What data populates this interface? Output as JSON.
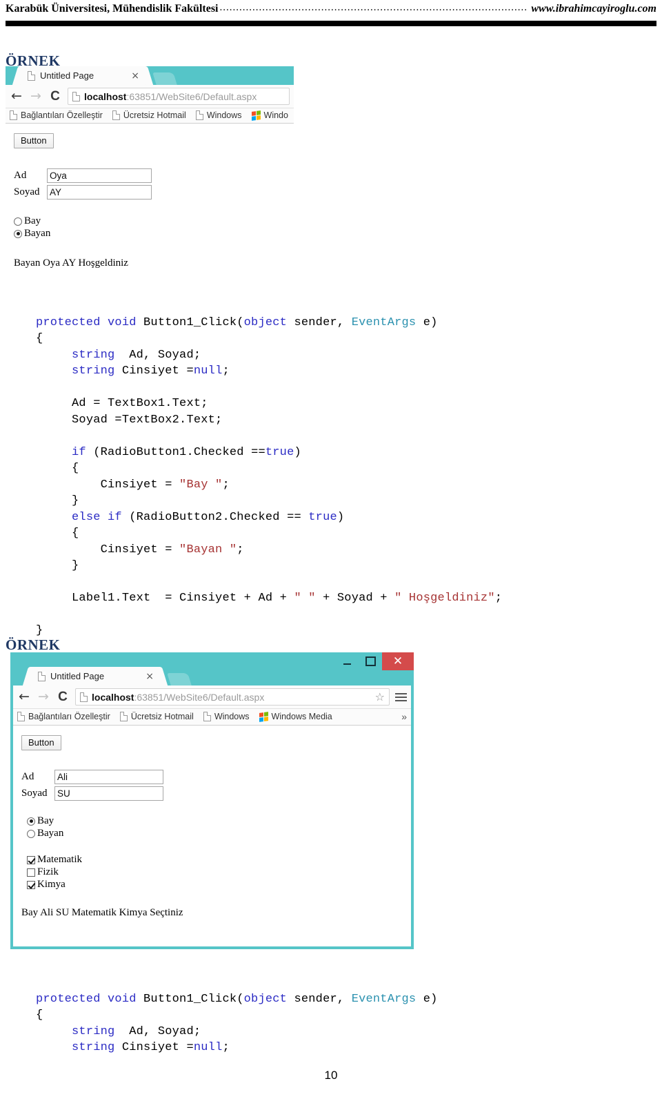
{
  "header": {
    "left": "Karabük Üniversitesi, Mühendislik Fakültesi",
    "dots": "..............................................................................................",
    "right": "www.ibrahimcayiroglu.com"
  },
  "sections": {
    "ornek_1": "ÖRNEK",
    "ornek_2": "ÖRNEK"
  },
  "browser1": {
    "tab_title": "Untitled Page",
    "tab_close": "×",
    "nav": {
      "back": "←",
      "forward": "→",
      "reload": "C"
    },
    "url_bold": "localhost",
    "url_rest": ":63851/WebSite6/Default.aspx",
    "bookmarks": [
      {
        "label": "Bağlantıları Özelleştir",
        "icon": "doc-icon"
      },
      {
        "label": "Ücretsiz Hotmail",
        "icon": "doc-icon"
      },
      {
        "label": "Windows",
        "icon": "doc-icon"
      },
      {
        "label": "Windo",
        "icon": "windows-logo-icon"
      }
    ],
    "page": {
      "button_label": "Button",
      "label_ad": "Ad",
      "value_ad": "Oya",
      "label_soyad": "Soyad",
      "value_soyad": "AY",
      "radio_bay": "Bay",
      "radio_bay_checked": false,
      "radio_bayan": "Bayan",
      "radio_bayan_checked": true,
      "result": "Bayan Oya AY Hoşgeldiniz"
    }
  },
  "browser2": {
    "tab_title": "Untitled Page",
    "tab_close": "×",
    "window_controls": {
      "minimize": "–",
      "maximize": "▫",
      "close": "✕"
    },
    "nav": {
      "back": "←",
      "forward": "→",
      "reload": "C"
    },
    "url_bold": "localhost",
    "url_rest": ":63851/WebSite6/Default.aspx",
    "star": "☆",
    "bookmarks": [
      {
        "label": "Bağlantıları Özelleştir",
        "icon": "doc-icon"
      },
      {
        "label": "Ücretsiz Hotmail",
        "icon": "doc-icon"
      },
      {
        "label": "Windows",
        "icon": "doc-icon"
      },
      {
        "label": "Windows Media",
        "icon": "windows-logo-icon"
      }
    ],
    "bookmarks_overflow": "»",
    "page": {
      "button_label": "Button",
      "label_ad": "Ad",
      "value_ad": "Ali",
      "label_soyad": "Soyad",
      "value_soyad": "SU",
      "radio_bay": "Bay",
      "radio_bay_checked": true,
      "radio_bayan": "Bayan",
      "radio_bayan_checked": false,
      "check_matematik": "Matematik",
      "check_matematik_checked": true,
      "check_fizik": "Fizik",
      "check_fizik_checked": false,
      "check_kimya": "Kimya",
      "check_kimya_checked": true,
      "result": "Bay Ali SU Matematik Kimya Seçtiniz"
    }
  },
  "code1": {
    "l01_a": "protected void ",
    "l01_b": "Button1_Click(",
    "l01_c": "object",
    "l01_d": " sender, ",
    "l01_e": "EventArgs",
    "l01_f": " e)",
    "l02": "{",
    "l03_kw": "string",
    "l03_rest": "  Ad, Soyad;",
    "l04_kw": "string",
    "l04_mid": " Cinsiyet =",
    "l04_null": "null",
    "l04_end": ";",
    "l05": "",
    "l06": "Ad = TextBox1.Text;",
    "l07": "Soyad =TextBox2.Text;",
    "l08": "",
    "l09_kw": "if",
    "l09_mid": " (RadioButton1.Checked ==",
    "l09_true": "true",
    "l09_end": ")",
    "l10": "{",
    "l11_a": "Cinsiyet = ",
    "l11_str": "\"Bay \"",
    "l11_end": ";",
    "l12": "}",
    "l13_kw": "else if",
    "l13_mid": " (RadioButton2.Checked == ",
    "l13_true": "true",
    "l13_end": ")",
    "l14": "{",
    "l15_a": "Cinsiyet = ",
    "l15_str": "\"Bayan \"",
    "l15_end": ";",
    "l16": "}",
    "l17": "",
    "l18_a": "Label1.Text  = Cinsiyet + Ad + ",
    "l18_s1": "\" \"",
    "l18_b": " + Soyad + ",
    "l18_s2": "\" Hoşgeldiniz\"",
    "l18_end": ";",
    "l19": "",
    "l20": "}"
  },
  "code2": {
    "l01_a": "protected void ",
    "l01_b": "Button1_Click(",
    "l01_c": "object",
    "l01_d": " sender, ",
    "l01_e": "EventArgs",
    "l01_f": " e)",
    "l02": "{",
    "l03_kw": "string",
    "l03_rest": "  Ad, Soyad;",
    "l04_kw": "string",
    "l04_mid": " Cinsiyet =",
    "l04_null": "null",
    "l04_end": ";"
  },
  "footer": {
    "page_number": "10"
  },
  "colors": {
    "teal": "#55C5C8",
    "close_red": "#D44B4B",
    "heading_blue": "#1F3864",
    "keyword_blue": "#2B2BC4",
    "type_teal": "#2B91AF",
    "string_red": "#A63333"
  }
}
